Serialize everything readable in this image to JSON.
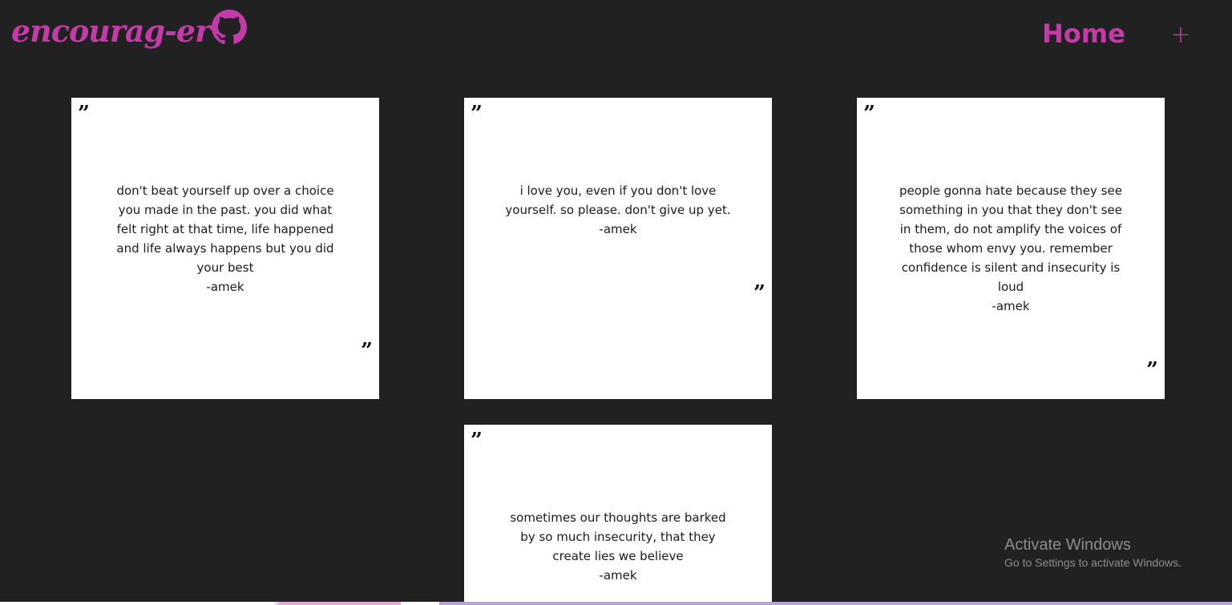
{
  "header": {
    "brand": "encourag-er",
    "home_label": "Home",
    "add_label": "+"
  },
  "quote_mark": "”",
  "cards": [
    {
      "text": "don't beat yourself up over a choice you made in the past. you did what felt right at that time, life happened and life always happens but you did your best",
      "author": "-amek"
    },
    {
      "text": "i love you, even if you don't love yourself. so please. don't give up yet.",
      "author": "-amek"
    },
    {
      "text": "people gonna hate because they see something in you that they don't see in them, do not amplify the voices of those whom envy you. remember confidence is silent and insecurity is loud",
      "author": "-amek"
    },
    {
      "text": "sometimes our thoughts are barked by so much insecurity, that they create lies we believe",
      "author": "-amek"
    }
  ],
  "watermark": {
    "title": "Activate Windows",
    "subtitle": "Go to Settings to activate Windows."
  },
  "colors": {
    "accent": "#c23ba8",
    "background": "#212121",
    "card": "#ffffff"
  }
}
